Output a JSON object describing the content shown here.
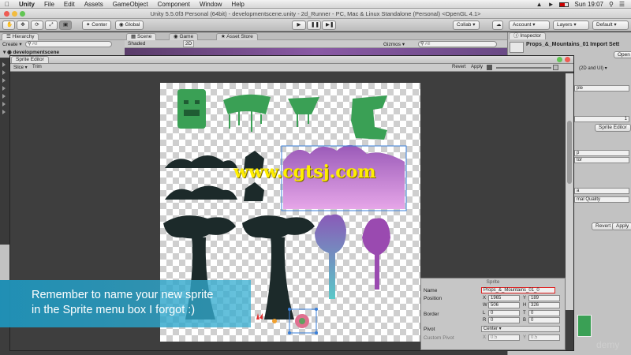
{
  "menubar": {
    "app": "Unity",
    "items": [
      "File",
      "Edit",
      "Assets",
      "GameObject",
      "Component",
      "Window",
      "Help"
    ],
    "time": "Sun 19:07"
  },
  "window_title": "Unity 5.5.0f3 Personal (64bit) - developmentscene.unity - 2d_Runner - PC, Mac & Linux Standalone (Personal) <OpenGL 4.1>",
  "toolbar": {
    "pivot_mode": "Center",
    "space_mode": "Global",
    "collab": "Collab",
    "account": "Account",
    "layers": "Layers",
    "layout": "Default"
  },
  "tabs": {
    "hierarchy": "Hierarchy",
    "scene": "Scene",
    "game": "Game",
    "asset_store": "Asset Store",
    "inspector": "Inspector"
  },
  "hierarchy": {
    "create": "Create",
    "search_placeholder": "All",
    "scene_name": "developmentscene"
  },
  "scene_view": {
    "shading": "Shaded",
    "mode_2d": "2D",
    "gizmos": "Gizmos",
    "search_placeholder": "All"
  },
  "inspector": {
    "asset_title": "Props_&_Mountains_01 Import Sett",
    "open": "Open",
    "mode": "(2D and UI)",
    "field_ple": "ple",
    "pixels_value": "1",
    "sprite_editor_button": "Sprite Editor",
    "field_p": "p",
    "field_tor": "tor",
    "field_a": "a",
    "quality": "mal Quality",
    "revert": "Revert",
    "apply": "Apply"
  },
  "sprite_editor": {
    "title": "Sprite Editor",
    "slice": "Slice",
    "trim": "Trim",
    "revert": "Revert",
    "apply": "Apply"
  },
  "sprite_panel": {
    "header": "Sprite",
    "name_label": "Name",
    "name_value": "Props_&_Mountains_01_0",
    "position_label": "Position",
    "x_label": "X",
    "x_value": "1965",
    "y_label": "Y",
    "y_value": "189",
    "w_label": "W",
    "w_value": "506",
    "h_label": "H",
    "h_value": "326",
    "border_label": "Border",
    "l_label": "L",
    "l_value": "0",
    "t_label": "T",
    "t_value": "0",
    "r_label": "R",
    "r_value": "0",
    "b_label": "B",
    "b_value": "0",
    "pivot_label": "Pivot",
    "pivot_value": "Center",
    "custom_pivot_label": "Custom Pivot",
    "cp_x_label": "X",
    "cp_x_value": "0.5",
    "cp_y_label": "Y",
    "cp_y_value": "0.5"
  },
  "banner": {
    "line1": "Remember to name your new sprite",
    "line2": "in the Sprite menu box I forgot :)"
  },
  "watermark": "www.cgtsj.com",
  "udemy": "demy",
  "colors": {
    "banner": "#2a9bc4",
    "selection": "#3a7fd8",
    "name_highlight": "#e02020",
    "jungle_green": "#3aa055",
    "silhouette": "#1c2a2a",
    "mountain_top": "#9a5ab8",
    "mountain_bottom": "#e6a6e8"
  }
}
